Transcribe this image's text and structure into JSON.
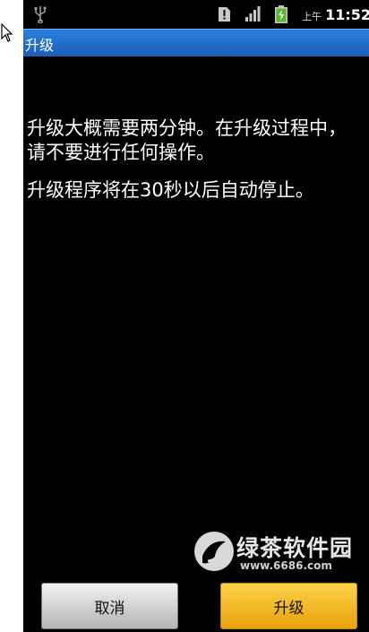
{
  "status_bar": {
    "ampm": "上午",
    "time": "11:52",
    "icons": [
      "usb-icon",
      "sim-alert-icon",
      "signal-icon",
      "battery-charging-icon"
    ]
  },
  "dialog": {
    "title": "升级",
    "message_line1": "升级大概需要两分钟。在升级过程中， 请不要进行任何操作。",
    "message_line2": "升级程序将在30秒以后自动停止。",
    "cancel_label": "取消",
    "upgrade_label": "升级"
  },
  "watermark": {
    "name": "绿茶软件园",
    "url": "www.6686.com"
  },
  "colors": {
    "titlebar": "#1e6ad0",
    "background": "#000000",
    "upgrade_button": "#f5b820",
    "cancel_button": "#d8d8d8"
  }
}
